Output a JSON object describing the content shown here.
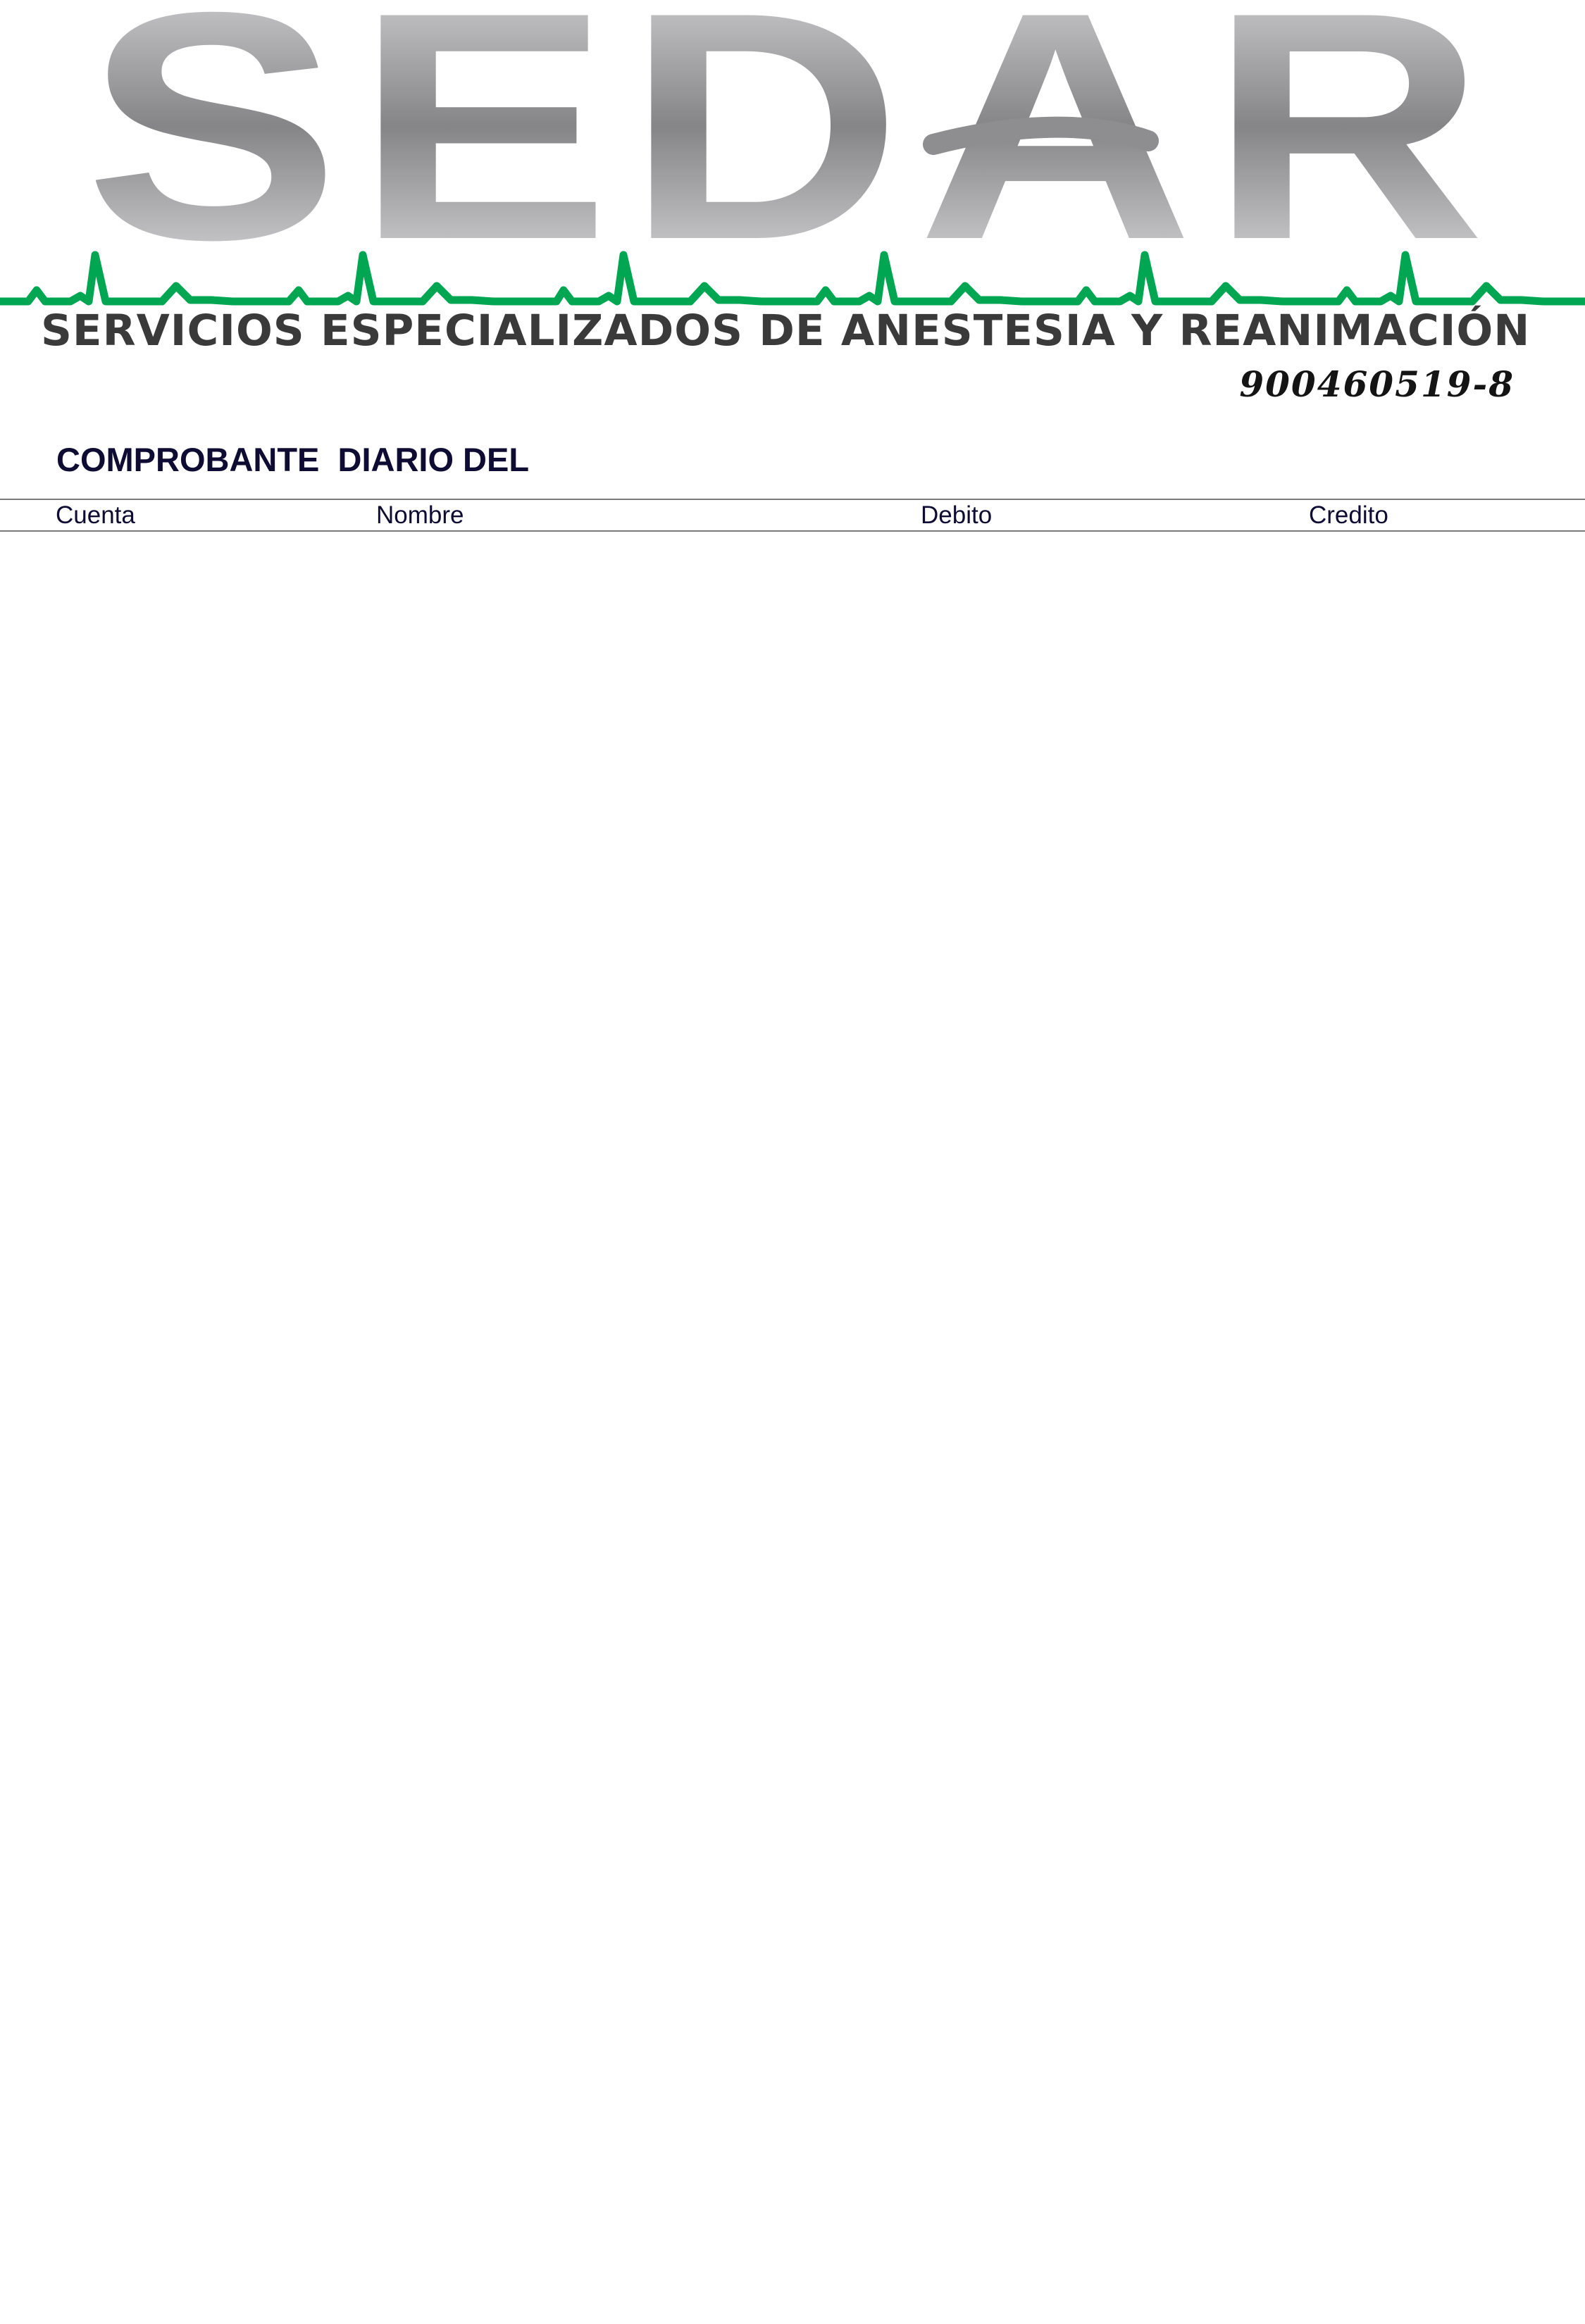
{
  "header": {
    "logo_text": "SEDAR",
    "company_name": "SERVICIOS ESPECIALIZADOS DE ANESTESIA Y REANIMACIÓN",
    "nit": "900460519-8",
    "colors": {
      "logo_gray": "#8a8a8a",
      "pulse_green": "#00a651",
      "company_text": "#3a3a3a"
    }
  },
  "document": {
    "title": "COMPROBANTE  DIARIO DEL",
    "text_color": "#0f0c33"
  },
  "table": {
    "columns": [
      "Cuenta",
      "Nombre",
      "Debito",
      "Credito"
    ],
    "rows": []
  }
}
